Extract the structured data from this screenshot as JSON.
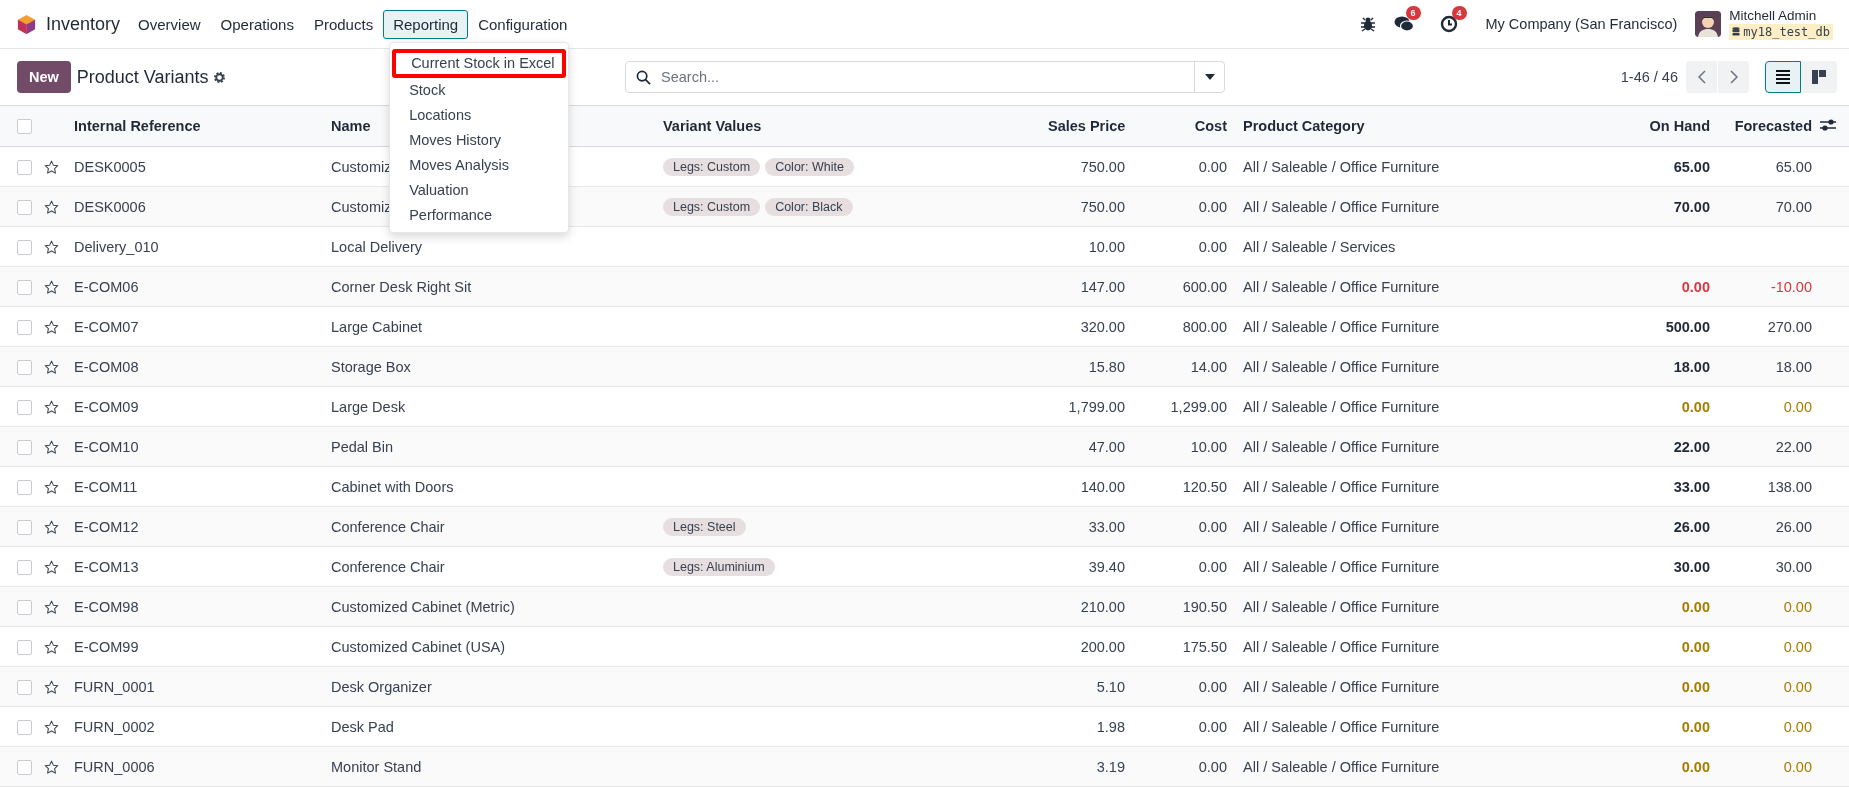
{
  "navbar": {
    "app_name": "Inventory",
    "menu": [
      {
        "label": "Overview",
        "selected": false
      },
      {
        "label": "Operations",
        "selected": false
      },
      {
        "label": "Products",
        "selected": false
      },
      {
        "label": "Reporting",
        "selected": true,
        "expanded": true,
        "items": [
          {
            "label": "Current Stock in Excel",
            "highlighted": true
          },
          {
            "label": "Stock",
            "highlighted": false
          },
          {
            "label": "Locations",
            "highlighted": false
          },
          {
            "label": "Moves History",
            "highlighted": false
          },
          {
            "label": "Moves Analysis",
            "highlighted": false
          },
          {
            "label": "Valuation",
            "highlighted": false
          },
          {
            "label": "Performance",
            "highlighted": false
          }
        ]
      },
      {
        "label": "Configuration",
        "selected": false
      }
    ],
    "messages_badge": "6",
    "activities_badge": "4",
    "company": "My Company (San Francisco)",
    "user_name": "Mitchell Admin",
    "database": "my18_test_db"
  },
  "control_panel": {
    "new_button": "New",
    "title": "Product Variants",
    "search": {
      "placeholder": "Search..."
    },
    "pager": "1-46 / 46",
    "views": [
      {
        "kind": "list",
        "selected": true
      },
      {
        "kind": "kanban",
        "selected": false
      }
    ]
  },
  "table": {
    "select_all": {
      "checked": false
    },
    "columns": [
      "Internal Reference",
      "Name",
      "Variant Values",
      "Sales Price",
      "Cost",
      "Product Category",
      "On Hand",
      "Forecasted"
    ],
    "rows": [
      {
        "selected": false,
        "favorite": false,
        "reference": "DESK0005",
        "name": "Customiz",
        "variants": [
          "Legs: Custom",
          "Color: White"
        ],
        "sales_price": "750.00",
        "cost": "0.00",
        "category": "All / Saleable / Office Furniture",
        "on_hand": {
          "text": "65.00",
          "color": "#1f2937"
        },
        "forecasted": {
          "text": "65.00",
          "color": "#374151"
        }
      },
      {
        "selected": false,
        "favorite": false,
        "reference": "DESK0006",
        "name": "Customiz",
        "variants": [
          "Legs: Custom",
          "Color: Black"
        ],
        "sales_price": "750.00",
        "cost": "0.00",
        "category": "All / Saleable / Office Furniture",
        "on_hand": {
          "text": "70.00",
          "color": "#1f2937"
        },
        "forecasted": {
          "text": "70.00",
          "color": "#374151"
        }
      },
      {
        "selected": false,
        "favorite": false,
        "reference": "Delivery_010",
        "name": "Local Delivery",
        "sales_price": "10.00",
        "cost": "0.00",
        "category": "All / Saleable / Services"
      },
      {
        "selected": false,
        "favorite": false,
        "reference": "E-COM06",
        "name": "Corner Desk Right Sit",
        "sales_price": "147.00",
        "cost": "600.00",
        "category": "All / Saleable / Office Furniture",
        "on_hand": {
          "text": "0.00",
          "color": "#d9363e"
        },
        "forecasted": {
          "text": "-10.00",
          "color": "#d9363e"
        }
      },
      {
        "selected": false,
        "favorite": false,
        "reference": "E-COM07",
        "name": "Large Cabinet",
        "sales_price": "320.00",
        "cost": "800.00",
        "category": "All / Saleable / Office Furniture",
        "on_hand": {
          "text": "500.00",
          "color": "#1f2937"
        },
        "forecasted": {
          "text": "270.00",
          "color": "#374151"
        }
      },
      {
        "selected": false,
        "favorite": false,
        "reference": "E-COM08",
        "name": "Storage Box",
        "sales_price": "15.80",
        "cost": "14.00",
        "category": "All / Saleable / Office Furniture",
        "on_hand": {
          "text": "18.00",
          "color": "#1f2937"
        },
        "forecasted": {
          "text": "18.00",
          "color": "#374151"
        }
      },
      {
        "selected": false,
        "favorite": false,
        "reference": "E-COM09",
        "name": "Large Desk",
        "sales_price": "1,799.00",
        "cost": "1,299.00",
        "category": "All / Saleable / Office Furniture",
        "on_hand": {
          "text": "0.00",
          "color": "#a67c00"
        },
        "forecasted": {
          "text": "0.00",
          "color": "#a67c00"
        }
      },
      {
        "selected": false,
        "favorite": false,
        "reference": "E-COM10",
        "name": "Pedal Bin",
        "sales_price": "47.00",
        "cost": "10.00",
        "category": "All / Saleable / Office Furniture",
        "on_hand": {
          "text": "22.00",
          "color": "#1f2937"
        },
        "forecasted": {
          "text": "22.00",
          "color": "#374151"
        }
      },
      {
        "selected": false,
        "favorite": false,
        "reference": "E-COM11",
        "name": "Cabinet with Doors",
        "sales_price": "140.00",
        "cost": "120.50",
        "category": "All / Saleable / Office Furniture",
        "on_hand": {
          "text": "33.00",
          "color": "#1f2937"
        },
        "forecasted": {
          "text": "138.00",
          "color": "#374151"
        }
      },
      {
        "selected": false,
        "favorite": false,
        "reference": "E-COM12",
        "name": "Conference Chair",
        "variants": [
          "Legs: Steel"
        ],
        "sales_price": "33.00",
        "cost": "0.00",
        "category": "All / Saleable / Office Furniture",
        "on_hand": {
          "text": "26.00",
          "color": "#1f2937"
        },
        "forecasted": {
          "text": "26.00",
          "color": "#374151"
        }
      },
      {
        "selected": false,
        "favorite": false,
        "reference": "E-COM13",
        "name": "Conference Chair",
        "variants": [
          "Legs: Aluminium"
        ],
        "sales_price": "39.40",
        "cost": "0.00",
        "category": "All / Saleable / Office Furniture",
        "on_hand": {
          "text": "30.00",
          "color": "#1f2937"
        },
        "forecasted": {
          "text": "30.00",
          "color": "#374151"
        }
      },
      {
        "selected": false,
        "favorite": false,
        "reference": "E-COM98",
        "name": "Customized Cabinet (Metric)",
        "sales_price": "210.00",
        "cost": "190.50",
        "category": "All / Saleable / Office Furniture",
        "on_hand": {
          "text": "0.00",
          "color": "#a67c00"
        },
        "forecasted": {
          "text": "0.00",
          "color": "#a67c00"
        }
      },
      {
        "selected": false,
        "favorite": false,
        "reference": "E-COM99",
        "name": "Customized Cabinet (USA)",
        "sales_price": "200.00",
        "cost": "175.50",
        "category": "All / Saleable / Office Furniture",
        "on_hand": {
          "text": "0.00",
          "color": "#a67c00"
        },
        "forecasted": {
          "text": "0.00",
          "color": "#a67c00"
        }
      },
      {
        "selected": false,
        "favorite": false,
        "reference": "FURN_0001",
        "name": "Desk Organizer",
        "sales_price": "5.10",
        "cost": "0.00",
        "category": "All / Saleable / Office Furniture",
        "on_hand": {
          "text": "0.00",
          "color": "#a67c00"
        },
        "forecasted": {
          "text": "0.00",
          "color": "#a67c00"
        }
      },
      {
        "selected": false,
        "favorite": false,
        "reference": "FURN_0002",
        "name": "Desk Pad",
        "sales_price": "1.98",
        "cost": "0.00",
        "category": "All / Saleable / Office Furniture",
        "on_hand": {
          "text": "0.00",
          "color": "#a67c00"
        },
        "forecasted": {
          "text": "0.00",
          "color": "#a67c00"
        }
      },
      {
        "selected": false,
        "favorite": false,
        "reference": "FURN_0006",
        "name": "Monitor Stand",
        "sales_price": "3.19",
        "cost": "0.00",
        "category": "All / Saleable / Office Furniture",
        "on_hand": {
          "text": "0.00",
          "color": "#a67c00"
        },
        "forecasted": {
          "text": "0.00",
          "color": "#a67c00"
        }
      }
    ]
  }
}
